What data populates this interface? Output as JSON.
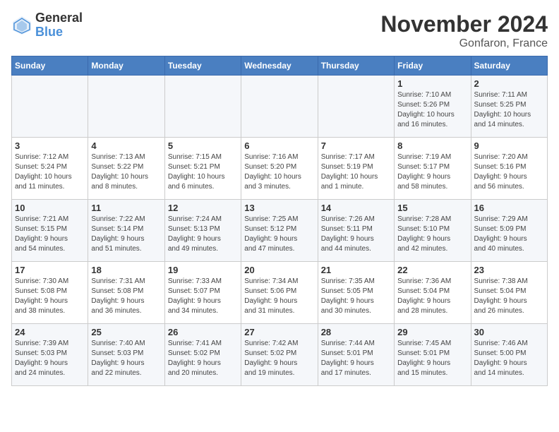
{
  "logo": {
    "general": "General",
    "blue": "Blue"
  },
  "title": "November 2024",
  "location": "Gonfaron, France",
  "days_of_week": [
    "Sunday",
    "Monday",
    "Tuesday",
    "Wednesday",
    "Thursday",
    "Friday",
    "Saturday"
  ],
  "weeks": [
    [
      {
        "day": "",
        "info": ""
      },
      {
        "day": "",
        "info": ""
      },
      {
        "day": "",
        "info": ""
      },
      {
        "day": "",
        "info": ""
      },
      {
        "day": "",
        "info": ""
      },
      {
        "day": "1",
        "info": "Sunrise: 7:10 AM\nSunset: 5:26 PM\nDaylight: 10 hours\nand 16 minutes."
      },
      {
        "day": "2",
        "info": "Sunrise: 7:11 AM\nSunset: 5:25 PM\nDaylight: 10 hours\nand 14 minutes."
      }
    ],
    [
      {
        "day": "3",
        "info": "Sunrise: 7:12 AM\nSunset: 5:24 PM\nDaylight: 10 hours\nand 11 minutes."
      },
      {
        "day": "4",
        "info": "Sunrise: 7:13 AM\nSunset: 5:22 PM\nDaylight: 10 hours\nand 8 minutes."
      },
      {
        "day": "5",
        "info": "Sunrise: 7:15 AM\nSunset: 5:21 PM\nDaylight: 10 hours\nand 6 minutes."
      },
      {
        "day": "6",
        "info": "Sunrise: 7:16 AM\nSunset: 5:20 PM\nDaylight: 10 hours\nand 3 minutes."
      },
      {
        "day": "7",
        "info": "Sunrise: 7:17 AM\nSunset: 5:19 PM\nDaylight: 10 hours\nand 1 minute."
      },
      {
        "day": "8",
        "info": "Sunrise: 7:19 AM\nSunset: 5:17 PM\nDaylight: 9 hours\nand 58 minutes."
      },
      {
        "day": "9",
        "info": "Sunrise: 7:20 AM\nSunset: 5:16 PM\nDaylight: 9 hours\nand 56 minutes."
      }
    ],
    [
      {
        "day": "10",
        "info": "Sunrise: 7:21 AM\nSunset: 5:15 PM\nDaylight: 9 hours\nand 54 minutes."
      },
      {
        "day": "11",
        "info": "Sunrise: 7:22 AM\nSunset: 5:14 PM\nDaylight: 9 hours\nand 51 minutes."
      },
      {
        "day": "12",
        "info": "Sunrise: 7:24 AM\nSunset: 5:13 PM\nDaylight: 9 hours\nand 49 minutes."
      },
      {
        "day": "13",
        "info": "Sunrise: 7:25 AM\nSunset: 5:12 PM\nDaylight: 9 hours\nand 47 minutes."
      },
      {
        "day": "14",
        "info": "Sunrise: 7:26 AM\nSunset: 5:11 PM\nDaylight: 9 hours\nand 44 minutes."
      },
      {
        "day": "15",
        "info": "Sunrise: 7:28 AM\nSunset: 5:10 PM\nDaylight: 9 hours\nand 42 minutes."
      },
      {
        "day": "16",
        "info": "Sunrise: 7:29 AM\nSunset: 5:09 PM\nDaylight: 9 hours\nand 40 minutes."
      }
    ],
    [
      {
        "day": "17",
        "info": "Sunrise: 7:30 AM\nSunset: 5:08 PM\nDaylight: 9 hours\nand 38 minutes."
      },
      {
        "day": "18",
        "info": "Sunrise: 7:31 AM\nSunset: 5:08 PM\nDaylight: 9 hours\nand 36 minutes."
      },
      {
        "day": "19",
        "info": "Sunrise: 7:33 AM\nSunset: 5:07 PM\nDaylight: 9 hours\nand 34 minutes."
      },
      {
        "day": "20",
        "info": "Sunrise: 7:34 AM\nSunset: 5:06 PM\nDaylight: 9 hours\nand 31 minutes."
      },
      {
        "day": "21",
        "info": "Sunrise: 7:35 AM\nSunset: 5:05 PM\nDaylight: 9 hours\nand 30 minutes."
      },
      {
        "day": "22",
        "info": "Sunrise: 7:36 AM\nSunset: 5:04 PM\nDaylight: 9 hours\nand 28 minutes."
      },
      {
        "day": "23",
        "info": "Sunrise: 7:38 AM\nSunset: 5:04 PM\nDaylight: 9 hours\nand 26 minutes."
      }
    ],
    [
      {
        "day": "24",
        "info": "Sunrise: 7:39 AM\nSunset: 5:03 PM\nDaylight: 9 hours\nand 24 minutes."
      },
      {
        "day": "25",
        "info": "Sunrise: 7:40 AM\nSunset: 5:03 PM\nDaylight: 9 hours\nand 22 minutes."
      },
      {
        "day": "26",
        "info": "Sunrise: 7:41 AM\nSunset: 5:02 PM\nDaylight: 9 hours\nand 20 minutes."
      },
      {
        "day": "27",
        "info": "Sunrise: 7:42 AM\nSunset: 5:02 PM\nDaylight: 9 hours\nand 19 minutes."
      },
      {
        "day": "28",
        "info": "Sunrise: 7:44 AM\nSunset: 5:01 PM\nDaylight: 9 hours\nand 17 minutes."
      },
      {
        "day": "29",
        "info": "Sunrise: 7:45 AM\nSunset: 5:01 PM\nDaylight: 9 hours\nand 15 minutes."
      },
      {
        "day": "30",
        "info": "Sunrise: 7:46 AM\nSunset: 5:00 PM\nDaylight: 9 hours\nand 14 minutes."
      }
    ]
  ]
}
